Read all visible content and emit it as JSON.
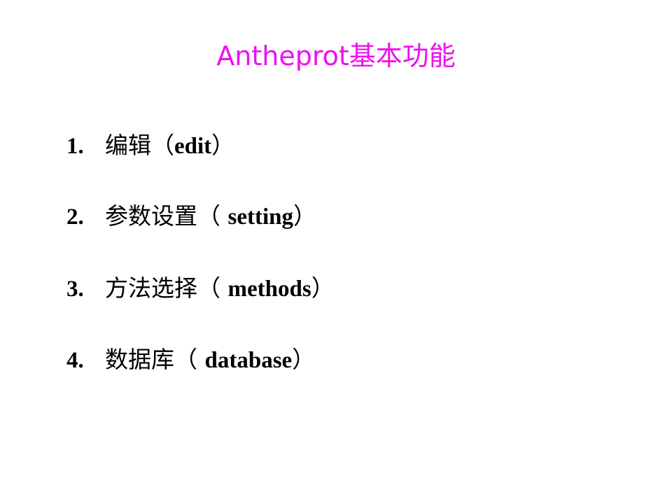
{
  "slide": {
    "title": "Antheprot基本功能",
    "items": [
      {
        "number": "1.",
        "name_cn": "编辑（",
        "name_en": "edit",
        "close": "）"
      },
      {
        "number": "2.",
        "name_cn": "参数设置（ ",
        "name_en": "setting",
        "close": "）"
      },
      {
        "number": "3.",
        "name_cn": "方法选择（ ",
        "name_en": "methods",
        "close": "）"
      },
      {
        "number": "4.",
        "name_cn": "数据库（ ",
        "name_en": "database",
        "close": "）"
      }
    ],
    "colors": {
      "title": "#ee10ee",
      "text": "#000000",
      "background": "#ffffff"
    }
  }
}
